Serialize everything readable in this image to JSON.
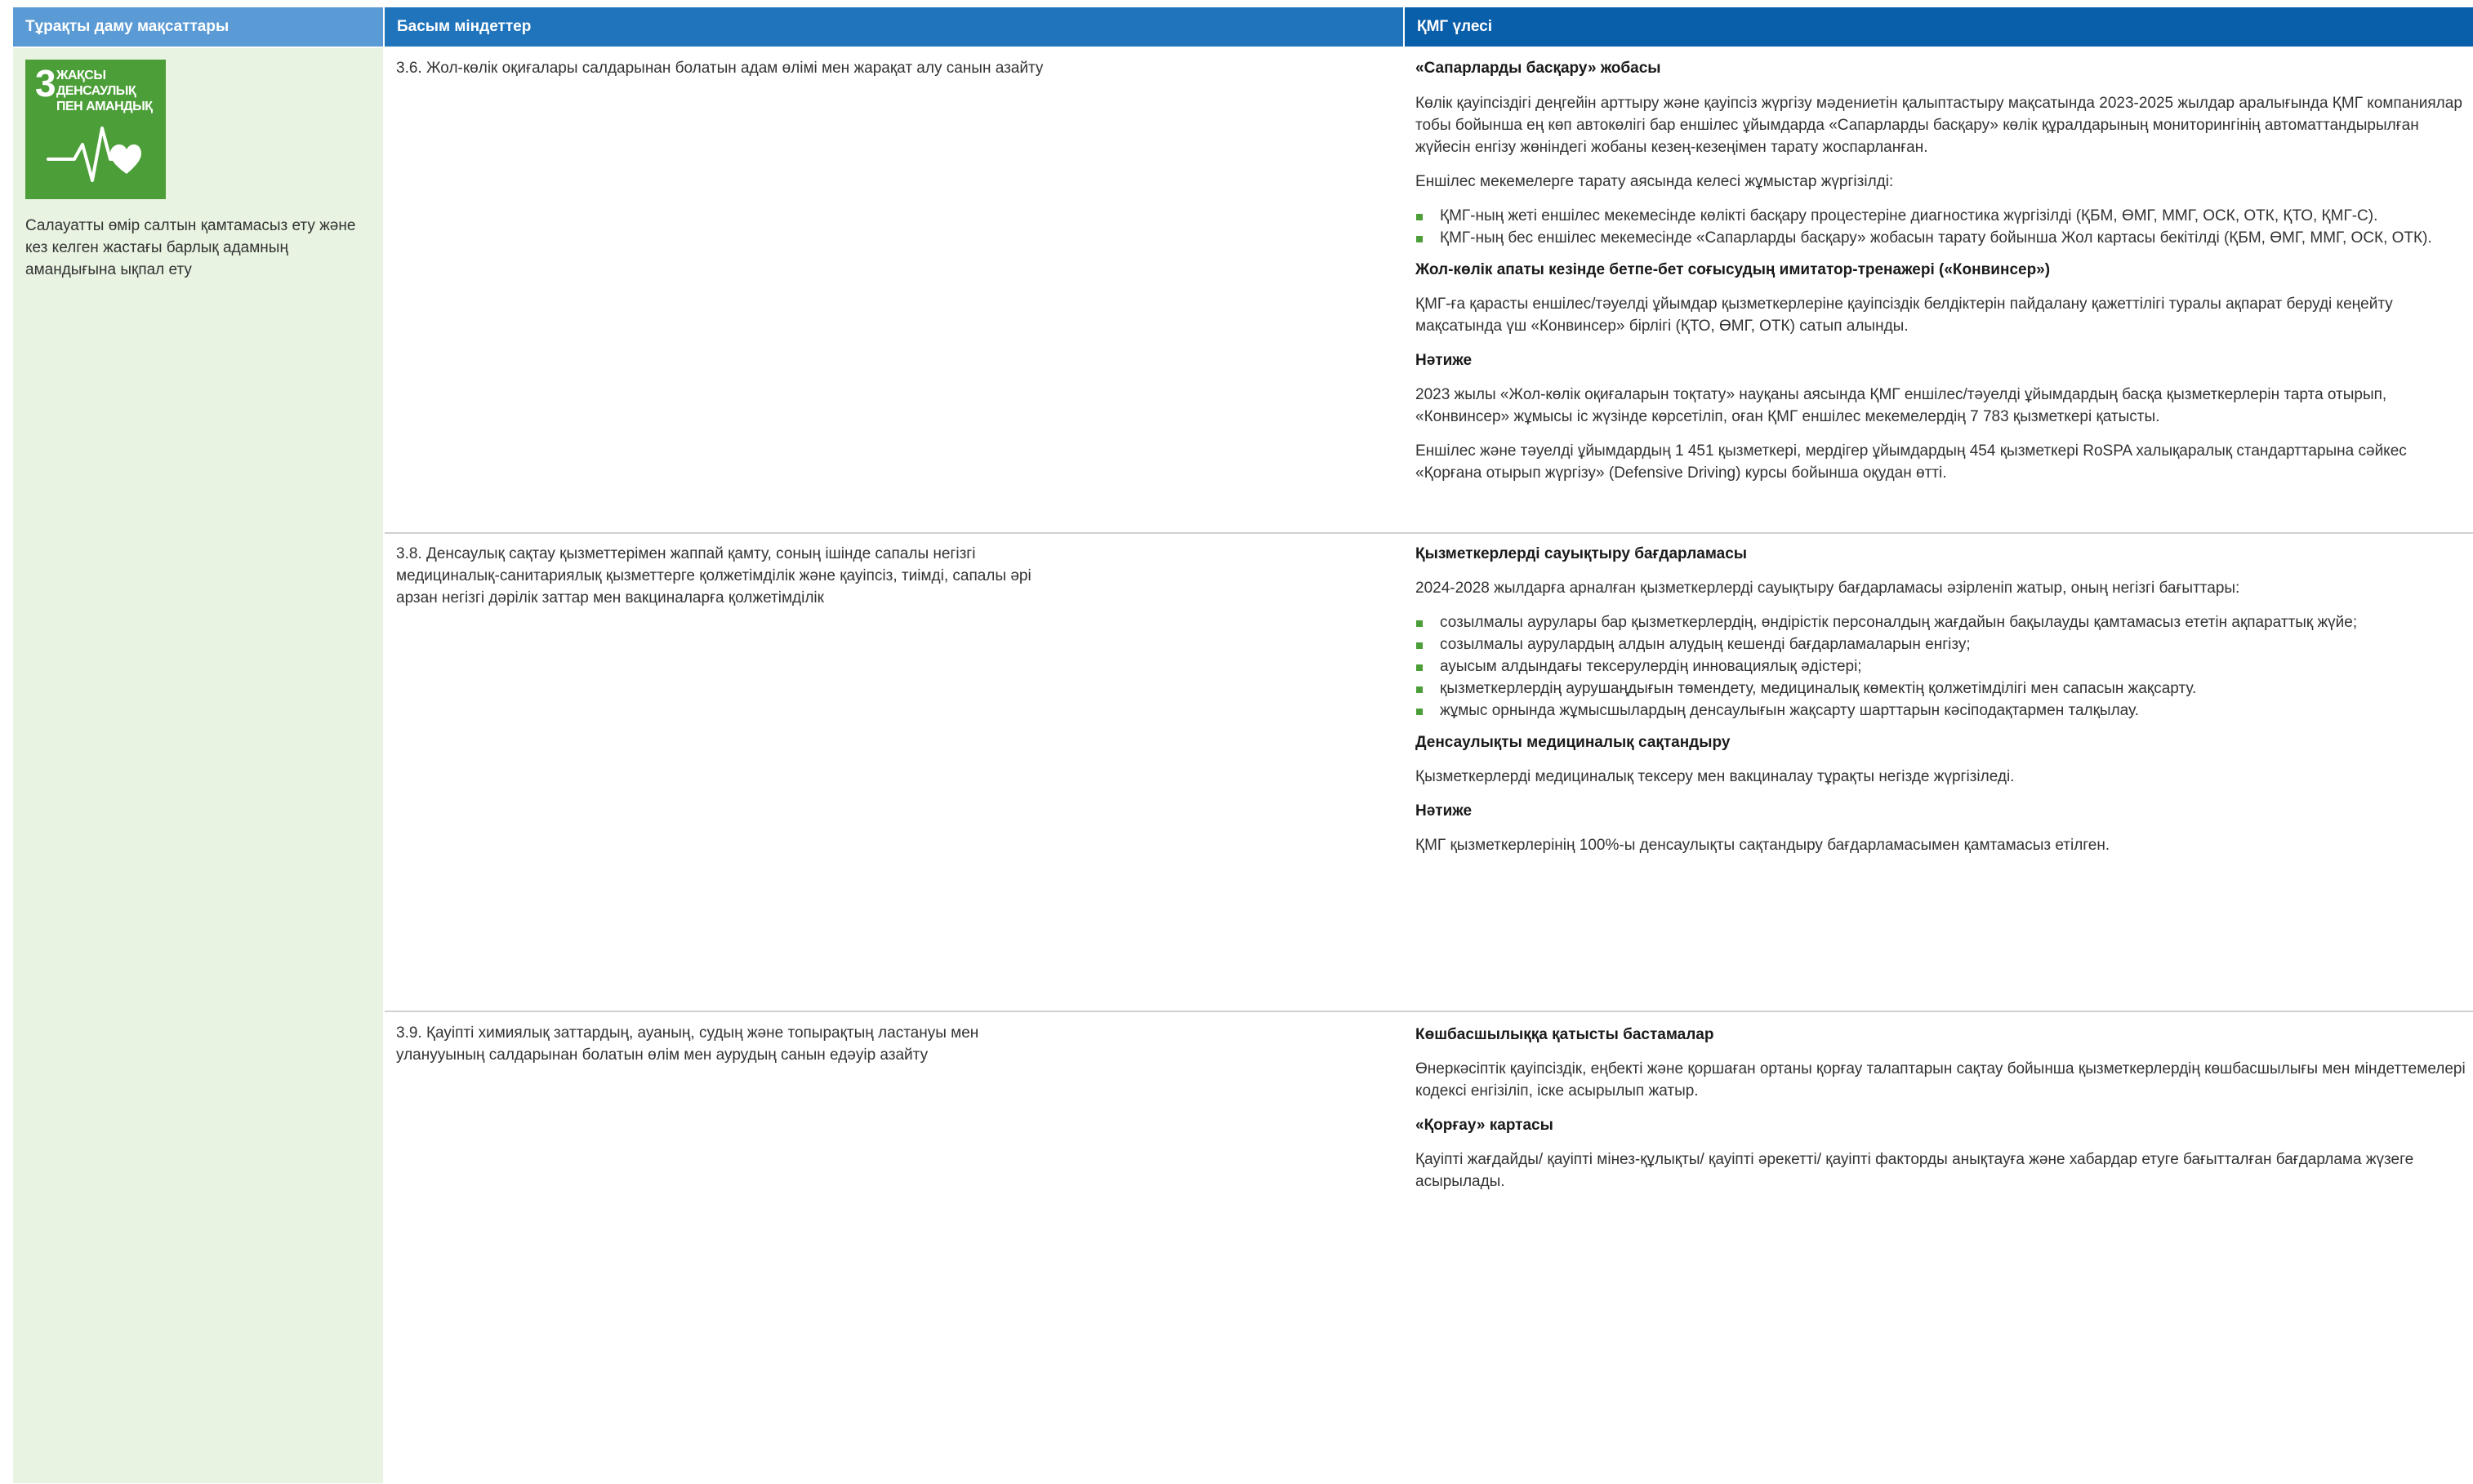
{
  "header": {
    "col1": "Тұрақты даму мақсаттары",
    "col2": "Басым міндеттер",
    "col3": "ҚМГ үлесі"
  },
  "sdg": {
    "number": "3",
    "title_line1": "ЖАҚСЫ ДЕНСАУЛЫҚ",
    "title_line2": "ПЕН АМАНДЫҚ",
    "icon": "heartbeat-heart-icon",
    "description": "Салауатты өмір салтын қамтамасыз ету және кез келген жастағы барлық адамның амандығына ықпал ету",
    "color": "#4c9f38"
  },
  "rows": [
    {
      "task": "3.6. Жол-көлік оқиғалары салдарынан болатын адам өлімі мен жарақат алу санын азайту",
      "b1_title": "«Сапарларды басқару» жобасы",
      "b1_p1": "Көлік қауіпсіздігі деңгейін арттыру және қауіпсіз жүргізу мәдениетін қалыптастыру мақсатында 2023-2025 жылдар аралығында ҚМГ компаниялар тобы бойынша ең көп автокөлігі бар еншілес ұйымдарда «Сапарларды басқару» көлік құралдарының мониторингінің автоматтандырылған жүйесін енгізу жөніндегі жобаны кезең-кезеңімен тарату жоспарланған.",
      "b1_p2": "Еншілес мекемелерге тарату аясында келесі жұмыстар жүргізілді:",
      "b1_items": [
        "ҚМГ-ның жеті еншілес мекемесінде көлікті басқару процестеріне диагностика жүргізілді (ҚБМ, ӨМГ, ММГ, ОСК, ОТК, ҚТО, ҚМГ-С).",
        "ҚМГ-ның бес еншілес мекемесінде «Сапарларды басқару» жобасын тарату бойынша Жол картасы бекітілді (ҚБМ, ӨМГ, ММГ, ОСК, ОТК)."
      ],
      "b2_title": "Жол-көлік апаты кезінде бетпе-бет соғысудың имитатор-тренажері («Конвинсер»)",
      "b2_p1": "ҚМГ-ға қарасты еншілес/тәуелді ұйымдар қызметкерлеріне қауіпсіздік белдіктерін пайдалану қажеттілігі туралы ақпарат беруді кеңейту мақсатында үш «Конвинсер» бірлігі (ҚТО, ӨМГ, ОТК) сатып алынды.",
      "b3_title": "Нәтиже",
      "b3_p1": "2023 жылы «Жол-көлік оқиғаларын тоқтату» науқаны аясында ҚМГ еншілес/тәуелді ұйымдардың басқа қызметкерлерін тарта отырып, «Конвинсер» жұмысы іс жүзінде көрсетіліп, оған ҚМГ еншілес мекемелердің 7 783 қызметкері қатысты.",
      "b3_p2": "Еншілес және тәуелді ұйымдардың 1 451 қызметкері, мердігер ұйымдардың 454 қызметкері RoSPA халықаралық стандарттарына сәйкес «Қорғана отырып жүргізу» (Defensive Driving) курсы бойынша оқудан өтті."
    },
    {
      "task": "3.8. Денсаулық сақтау қызметтерімен жаппай қамту, соның ішінде сапалы негізгі медициналық-санитариялық қызметтерге қолжетімділік және қауіпсіз, тиімді, сапалы әрі арзан негізгі дәрілік заттар мен вакциналарға қолжетімділік",
      "b1_title": "Қызметкерлерді сауықтыру бағдарламасы",
      "b1_p1": "2024-2028 жылдарға арналған қызметкерлерді сауықтыру бағдарламасы әзірленіп жатыр, оның негізгі бағыттары:",
      "b1_items": [
        "созылмалы аурулары бар қызметкерлердің, өндірістік персоналдың жағдайын бақылауды қамтамасыз ететін ақпараттық жүйе;",
        "созылмалы аурулардың алдын алудың кешенді бағдарламаларын енгізу;",
        "ауысым алдындағы тексерулердің инновациялық әдістері;",
        "қызметкерлердің аурушаңдығын төмендету, медициналық көмектің қолжетімділігі мен сапасын жақсарту.",
        "жұмыс орнында жұмысшылардың денсаулығын жақсарту шарттарын кәсіподақтармен талқылау."
      ],
      "b2_title": "Денсаулықты медициналық сақтандыру",
      "b2_p1": "Қызметкерлерді медициналық тексеру мен вакциналау тұрақты негізде жүргізіледі.",
      "b3_title": "Нәтиже",
      "b3_p1": "ҚМГ қызметкерлерінің 100%-ы денсаулықты сақтандыру бағдарламасымен қамтамасыз етілген."
    },
    {
      "task": "3.9. Қауіпті химиялық заттардың, ауаның, судың және топырақтың ластануы мен уланууының салдарынан болатын өлім мен аурудың санын едәуір азайту",
      "b1_title": "Көшбасшылыққа қатысты бастамалар",
      "b1_p1": "Өнеркәсіптік қауіпсіздік, еңбекті және қоршаған ортаны қорғау талаптарын сақтау бойынша қызметкерлердің көшбасшылығы мен міндеттемелері кодексі енгізіліп, іске асырылып жатыр.",
      "b2_title": "«Қорғау» картасы",
      "b2_p1": "Қауіпті жағдайды/ қауіпті мінез-құлықты/ қауіпті әрекетті/ қауіпті факторды анықтауға және хабардар етуге бағытталған бағдарлама жүзеге асырылады."
    }
  ]
}
